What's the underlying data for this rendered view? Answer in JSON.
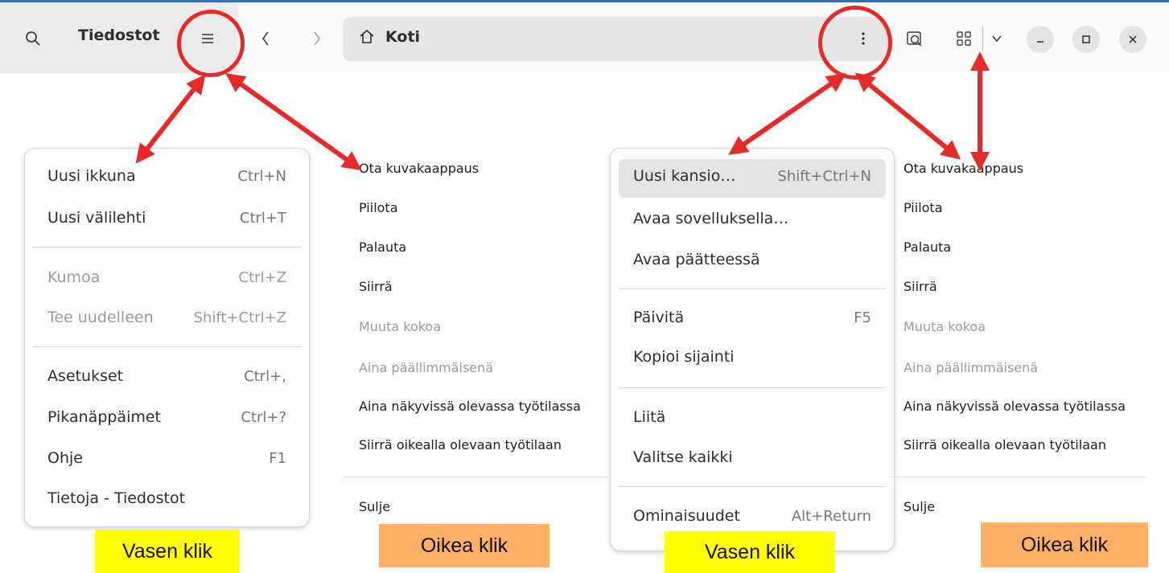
{
  "header": {
    "app_title": "Tiedostot",
    "path_label": "Koti"
  },
  "left_menu": {
    "items": [
      {
        "label": "Uusi ikkuna",
        "shortcut": "Ctrl+N",
        "enabled": true
      },
      {
        "label": "Uusi välilehti",
        "shortcut": "Ctrl+T",
        "enabled": true
      },
      {
        "label": "Kumoa",
        "shortcut": "Ctrl+Z",
        "enabled": false
      },
      {
        "label": "Tee uudelleen",
        "shortcut": "Shift+Ctrl+Z",
        "enabled": false
      },
      {
        "label": "Asetukset",
        "shortcut": "Ctrl+,",
        "enabled": true
      },
      {
        "label": "Pikanäppäimet",
        "shortcut": "Ctrl+?",
        "enabled": true
      },
      {
        "label": "Ohje",
        "shortcut": "F1",
        "enabled": true
      },
      {
        "label": "Tietoja - Tiedostot",
        "shortcut": "",
        "enabled": true
      }
    ]
  },
  "right_menu": {
    "items": [
      {
        "label": "Uusi kansio…",
        "shortcut": "Shift+Ctrl+N",
        "highlighted": true
      },
      {
        "label": "Avaa sovelluksella…",
        "shortcut": ""
      },
      {
        "label": "Avaa päätteessä",
        "shortcut": ""
      },
      {
        "label": "Päivitä",
        "shortcut": "F5"
      },
      {
        "label": "Kopioi sijainti",
        "shortcut": ""
      },
      {
        "label": "Liitä",
        "shortcut": ""
      },
      {
        "label": "Valitse kaikki",
        "shortcut": ""
      },
      {
        "label": "Ominaisuudet",
        "shortcut": "Alt+Return"
      }
    ]
  },
  "window_menu": {
    "items": [
      {
        "label": "Ota kuvakaappaus",
        "enabled": true
      },
      {
        "label": "Piilota",
        "enabled": true
      },
      {
        "label": "Palauta",
        "enabled": true
      },
      {
        "label": "Siirrä",
        "enabled": true
      },
      {
        "label": "Muuta kokoa",
        "enabled": false
      },
      {
        "label": "Aina päällimmäisenä",
        "enabled": false
      },
      {
        "label": "Aina näkyvissä olevassa työtilassa",
        "enabled": true
      },
      {
        "label": "Siirrä oikealla olevaan työtilaan",
        "enabled": true
      },
      {
        "label": "Sulje",
        "enabled": true
      }
    ]
  },
  "captions": {
    "left_click_1": "Vasen klik",
    "right_click_1": "Oikea klik",
    "left_click_2": "Vasen klik",
    "right_click_2": "Oikea klik"
  },
  "icons": {
    "search": "search-icon",
    "hamburger": "hamburger-menu-icon",
    "back": "back-icon",
    "forward": "forward-icon",
    "home": "home-icon",
    "more": "more-options-icon",
    "find": "find-icon",
    "grid": "grid-view-icon",
    "chevron": "chevron-down-icon",
    "minimize": "minimize-icon",
    "maximize": "maximize-icon",
    "close": "close-icon"
  },
  "colors": {
    "annotation_red": "#e52a2a",
    "caption_yellow": "#ffff00",
    "caption_orange": "#ffb066",
    "header_sidebar": "#ebebeb",
    "pathbar": "#e6e6e6"
  }
}
